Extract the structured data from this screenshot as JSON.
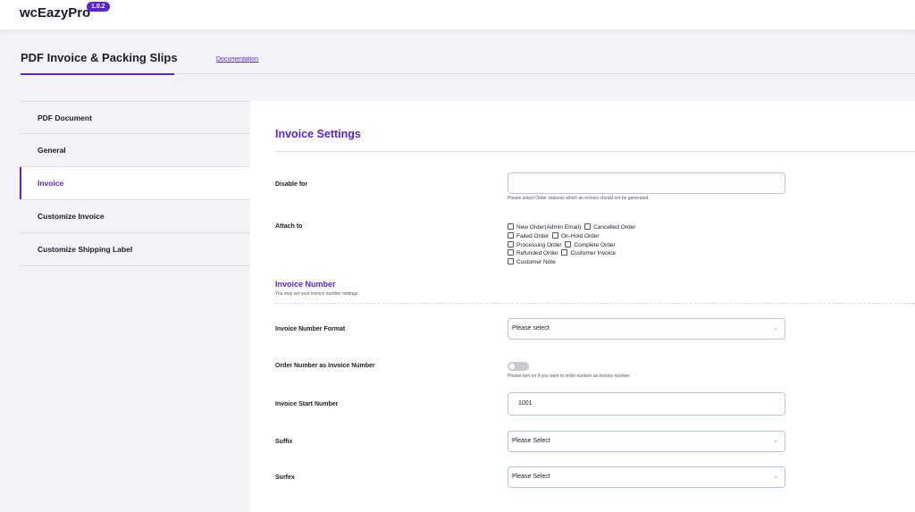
{
  "app": {
    "name": "wcEazyPro",
    "version": "1.0.2"
  },
  "header": {
    "title": "PDF Invoice & Packing Slips",
    "doc_link": "Documentation"
  },
  "sidebar": {
    "items": [
      {
        "label": "PDF Document"
      },
      {
        "label": "General"
      },
      {
        "label": "Invoice",
        "active": true
      },
      {
        "label": "Customize Invoice"
      },
      {
        "label": "Customize Shipping Label"
      }
    ]
  },
  "main": {
    "title": "Invoice Settings",
    "disable_for": {
      "label": "Disable for",
      "value": "",
      "help": "Please select Order statuses which an invoice should not be generated."
    },
    "attach_to": {
      "label": "Attach to",
      "options": [
        "New Order(Admin Email)",
        "Cancelled Order",
        "Failed Order",
        "On-Hold Order",
        "Processing Order",
        "Complete Order",
        "Refunded Order",
        "Customer Invoice",
        "Customer Note"
      ]
    },
    "invoice_number": {
      "title": "Invoice Number",
      "desc": "You may set your invoice number settings."
    },
    "format": {
      "label": "Invoice Number Format",
      "value": "Please select"
    },
    "order_as_invoice": {
      "label": "Order Number as Invoice Number",
      "enabled": false,
      "help": "Please turn on if you want to order number as invoice number."
    },
    "start_number": {
      "label": "Invoice Start Number",
      "value": "1001"
    },
    "suffix": {
      "label": "Suffix",
      "value": "Please Select"
    },
    "surfex": {
      "label": "Surfex",
      "value": "Please Select"
    }
  },
  "colors": {
    "accent": "#5b22d6",
    "border": "#b9c3ea",
    "background": "#f3f3f7"
  },
  "icons": {
    "select_chevron": "chevron-down-icon"
  }
}
